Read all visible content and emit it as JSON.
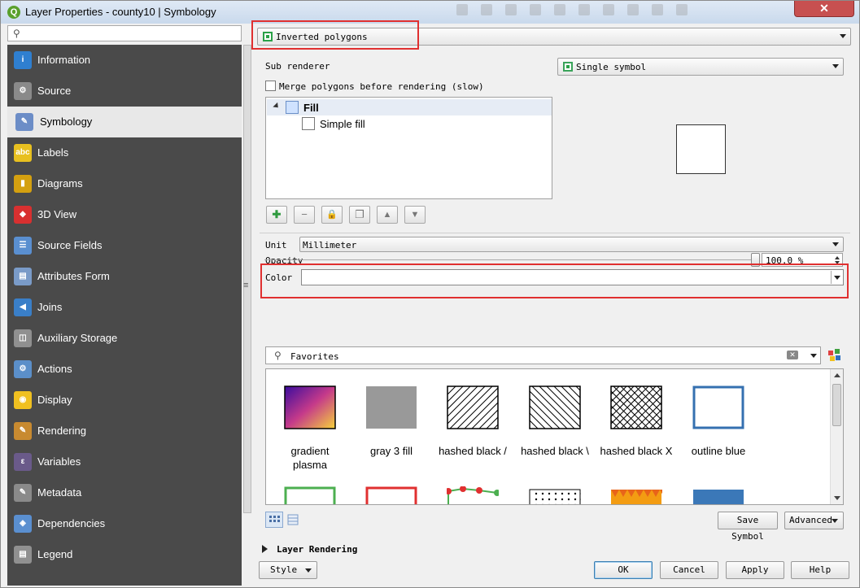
{
  "window": {
    "title": "Layer Properties - county10 | Symbology",
    "close_label": "✕"
  },
  "left_search": {
    "placeholder": ""
  },
  "sidebar": {
    "items": [
      {
        "label": "Information",
        "icon": "information-icon",
        "color": "#2f7fd0",
        "glyph": "i"
      },
      {
        "label": "Source",
        "icon": "source-wrench-icon",
        "color": "#8a8a8a",
        "glyph": "⚙"
      },
      {
        "label": "Symbology",
        "icon": "symbology-brush-icon",
        "color": "#6c8dc7",
        "glyph": "✎",
        "active": true
      },
      {
        "label": "Labels",
        "icon": "labels-abc-icon",
        "color": "#e8c020",
        "glyph": "abc"
      },
      {
        "label": "Diagrams",
        "icon": "diagrams-icon",
        "color": "#d4a010",
        "glyph": "▮"
      },
      {
        "label": "3D View",
        "icon": "3d-view-cube-icon",
        "color": "#d83030",
        "glyph": "◆"
      },
      {
        "label": "Source Fields",
        "icon": "source-fields-icon",
        "color": "#5a8fd0",
        "glyph": "☰"
      },
      {
        "label": "Attributes Form",
        "icon": "attributes-form-icon",
        "color": "#7a9bc8",
        "glyph": "▤"
      },
      {
        "label": "Joins",
        "icon": "joins-icon",
        "color": "#3a7fc8",
        "glyph": "◀"
      },
      {
        "label": "Auxiliary Storage",
        "icon": "auxiliary-storage-icon",
        "color": "#909090",
        "glyph": "◫"
      },
      {
        "label": "Actions",
        "icon": "actions-gear-icon",
        "color": "#5b8fc9",
        "glyph": "⚙"
      },
      {
        "label": "Display",
        "icon": "display-bubble-icon",
        "color": "#f0c020",
        "glyph": "◉"
      },
      {
        "label": "Rendering",
        "icon": "rendering-brush-icon",
        "color": "#c88a30",
        "glyph": "✎"
      },
      {
        "label": "Variables",
        "icon": "variables-epsilon-icon",
        "color": "#6a5a8a",
        "glyph": "ε"
      },
      {
        "label": "Metadata",
        "icon": "metadata-icon",
        "color": "#8a8a8a",
        "glyph": "✎"
      },
      {
        "label": "Dependencies",
        "icon": "dependencies-icon",
        "color": "#5a8fd0",
        "glyph": "◈"
      },
      {
        "label": "Legend",
        "icon": "legend-icon",
        "color": "#909090",
        "glyph": "▤"
      }
    ]
  },
  "renderer": {
    "selected": "Inverted polygons"
  },
  "sub_renderer": {
    "label": "Sub renderer",
    "selected": "Single symbol"
  },
  "merge_polygons": {
    "label": "Merge polygons before rendering (slow)",
    "checked": false
  },
  "symbol_tree": {
    "root": "Fill",
    "child": "Simple fill"
  },
  "layer_toolbar": {
    "add": "✚",
    "remove": "−",
    "lock": "🔒",
    "duplicate": "❐",
    "up": "▲",
    "down": "▼"
  },
  "unit": {
    "label": "Unit",
    "selected": "Millimeter"
  },
  "opacity": {
    "label": "Opacity",
    "value": "100.0 %",
    "percent": 100
  },
  "color": {
    "label": "Color",
    "swatch": "#ffffff"
  },
  "favorites": {
    "placeholder": "Favorites"
  },
  "symbols": [
    {
      "line1": "gradient",
      "line2": "plasma",
      "swatch": "gradient"
    },
    {
      "line1": "gray 3 fill",
      "line2": "",
      "swatch": "gray"
    },
    {
      "line1": "hashed black /",
      "line2": "",
      "swatch": "hash-fwd"
    },
    {
      "line1": "hashed black \\",
      "line2": "",
      "swatch": "hash-back"
    },
    {
      "line1": "hashed black X",
      "line2": "",
      "swatch": "hash-x"
    },
    {
      "line1": "outline blue",
      "line2": "",
      "swatch": "outline-blue"
    }
  ],
  "symbols_row2": [
    "outline-green",
    "outline-red",
    "dotted-line",
    "dots",
    "triangles",
    "blue-fill"
  ],
  "buttons": {
    "save_symbol": "Save Symbol",
    "advanced": "Advanced",
    "layer_rendering": "Layer Rendering",
    "style": "Style",
    "ok": "OK",
    "cancel": "Cancel",
    "apply": "Apply",
    "help": "Help"
  }
}
